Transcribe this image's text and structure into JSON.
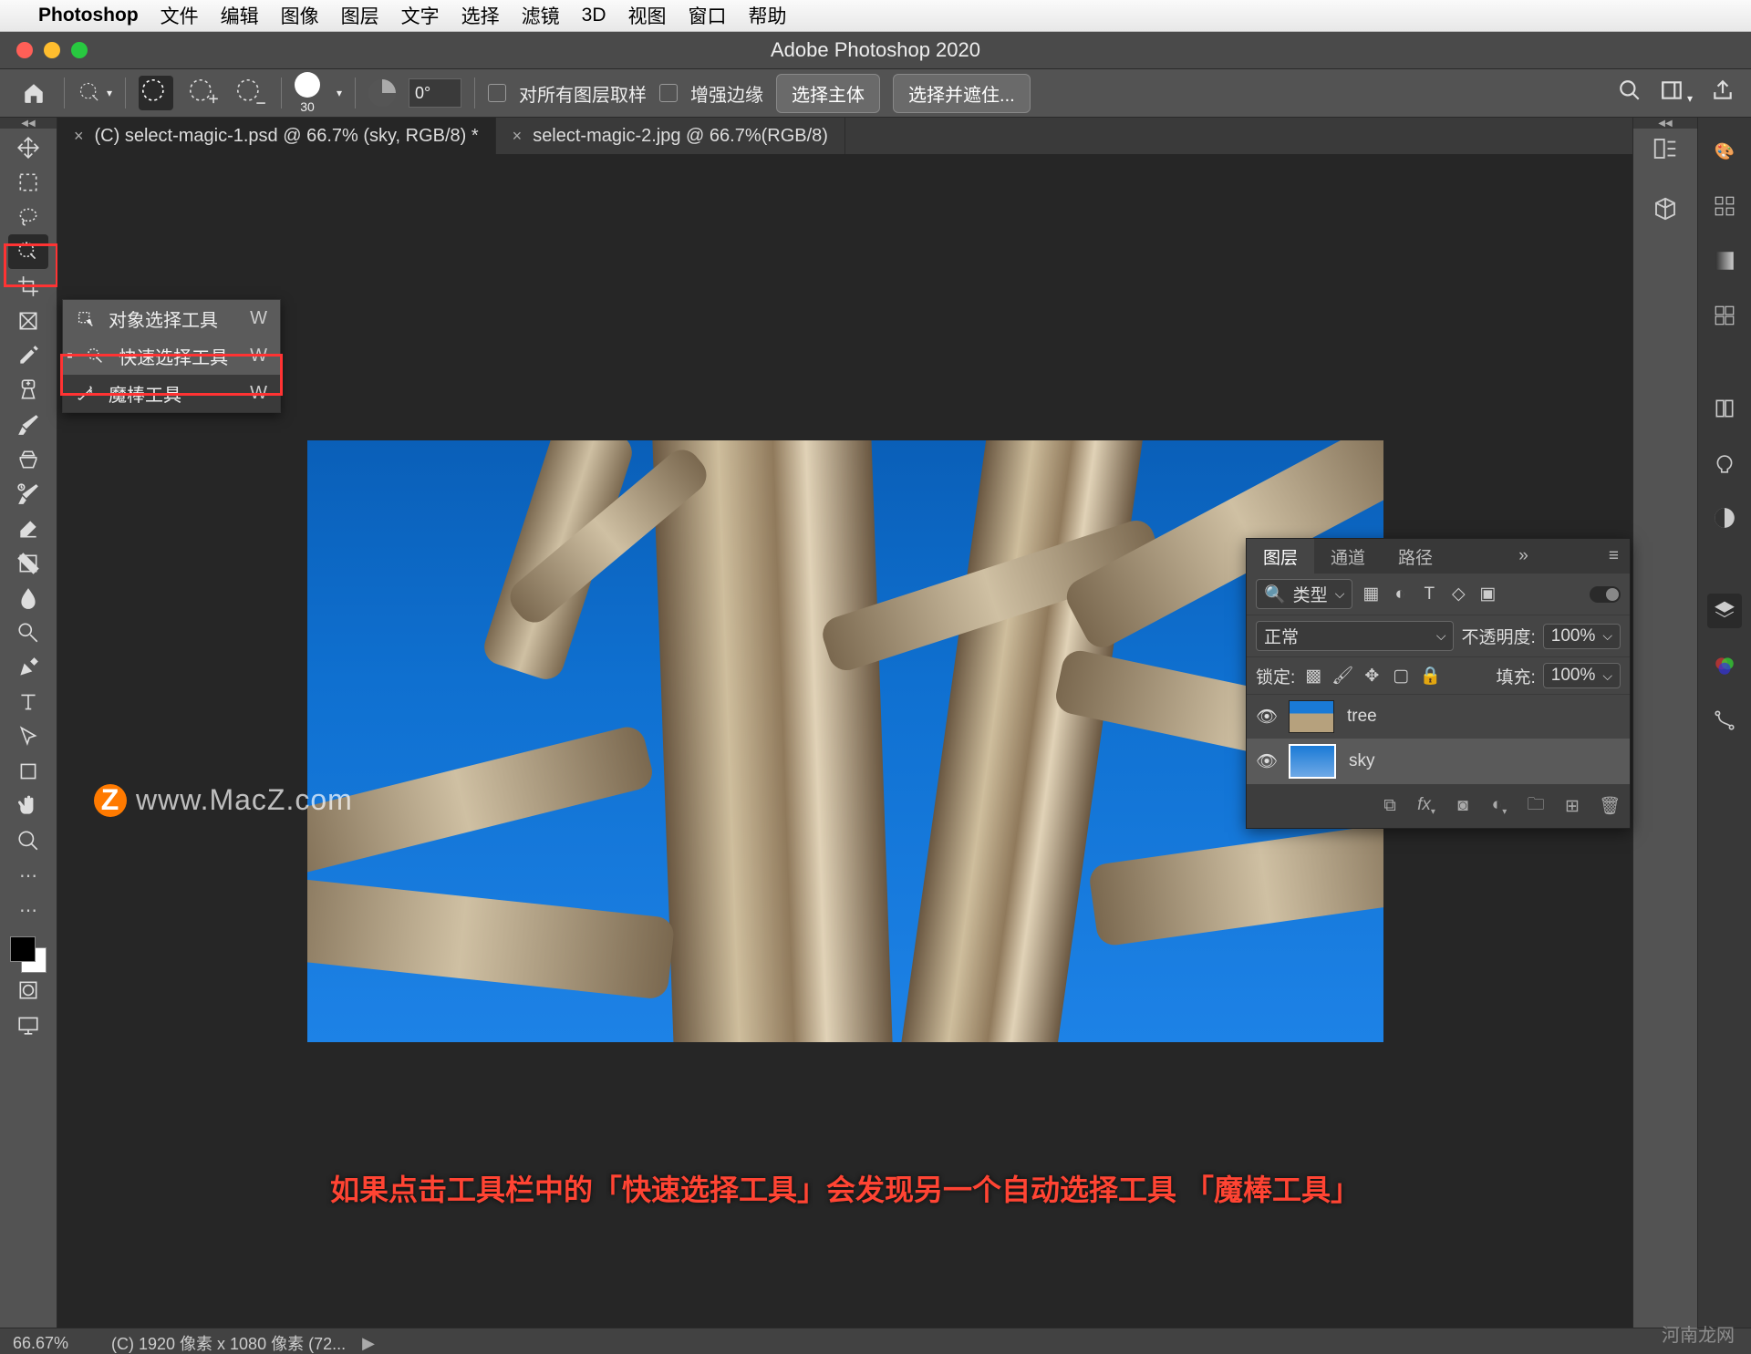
{
  "mac_menu": {
    "app": "Photoshop",
    "items": [
      "文件",
      "编辑",
      "图像",
      "图层",
      "文字",
      "选择",
      "滤镜",
      "3D",
      "视图",
      "窗口",
      "帮助"
    ]
  },
  "window": {
    "title": "Adobe Photoshop 2020"
  },
  "options": {
    "brush_size": "30",
    "angle": "0°",
    "sample_all": "对所有图层取样",
    "enhance_edge": "增强边缘",
    "select_subject": "选择主体",
    "select_and_mask": "选择并遮住..."
  },
  "tabs": [
    {
      "label": "(C) select-magic-1.psd @ 66.7% (sky, RGB/8) *",
      "active": true
    },
    {
      "label": "select-magic-2.jpg @ 66.7%(RGB/8)",
      "active": false
    }
  ],
  "flyout": {
    "items": [
      {
        "label": "对象选择工具",
        "shortcut": "W"
      },
      {
        "label": "快速选择工具",
        "shortcut": "W"
      },
      {
        "label": "魔棒工具",
        "shortcut": "W"
      }
    ]
  },
  "watermark": "www.MacZ.com",
  "caption": "如果点击工具栏中的「快速选择工具」会发现另一个自动选择工具 「魔棒工具」",
  "layers_panel": {
    "tabs": [
      "图层",
      "通道",
      "路径"
    ],
    "filter": {
      "type": "类型"
    },
    "blend": {
      "mode": "正常",
      "opacity_label": "不透明度:",
      "opacity": "100%",
      "lock_label": "锁定:",
      "fill_label": "填充:",
      "fill": "100%"
    },
    "layers": [
      {
        "name": "tree",
        "visible": true,
        "selected": false
      },
      {
        "name": "sky",
        "visible": true,
        "selected": true
      }
    ]
  },
  "status": {
    "zoom": "66.67%",
    "doc": "(C) 1920 像素 x 1080 像素 (72..."
  },
  "footer_wm": "河南龙网"
}
